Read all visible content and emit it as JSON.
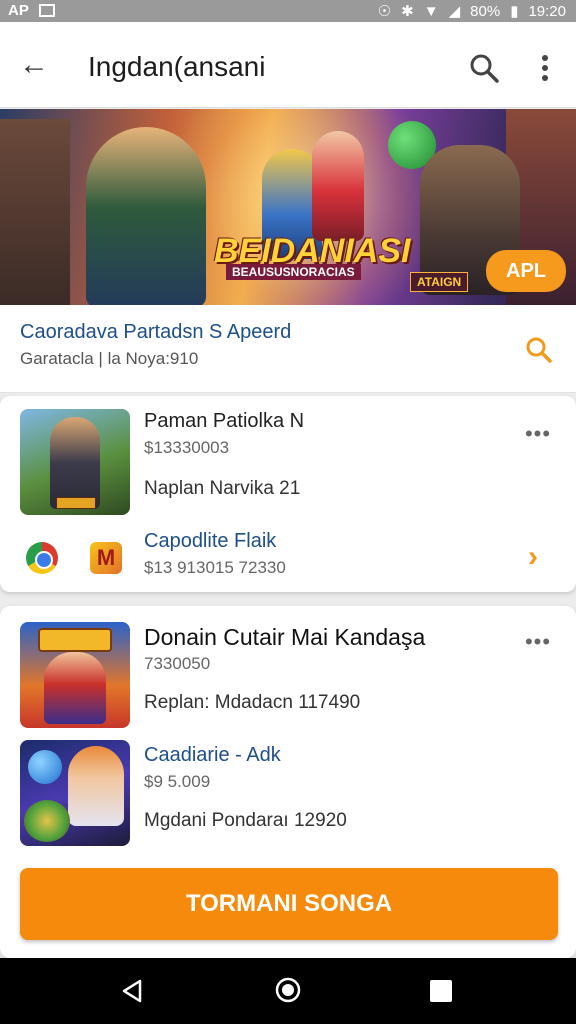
{
  "status_bar": {
    "left_text": "AP",
    "battery": "80%",
    "time": "19:20"
  },
  "app_bar": {
    "title": "Ingdan(ansani"
  },
  "banner": {
    "title": "BEIDANIASI",
    "subtitle": "BEAUSUSNORACIAS",
    "tag": "ATAIGN",
    "apply_label": "APL"
  },
  "info": {
    "title": "Caoradava Partadsn S Apeerd",
    "subtitle": "Garatacla | la Noya:910"
  },
  "card1": {
    "item": {
      "title": "Paman Patiolka N",
      "price": "$13330003",
      "meta": "Naplan Narvika 21"
    },
    "link": {
      "label": "Capodlite Flaik",
      "value": "$13 913015 72330"
    }
  },
  "card2": {
    "items": [
      {
        "title": "Donain Cutair Mai Kandaşa",
        "price": "7330050",
        "meta": "Replan: Mdadacn 117490"
      },
      {
        "title": "Caadiarie - Adk",
        "price": "$9 5.009",
        "meta": "Mgdani Pondaraı 12920"
      }
    ]
  },
  "cta": {
    "label": "TORMANI SONGA"
  },
  "colors": {
    "accent": "#f58a0c",
    "link": "#1e4f8a"
  }
}
